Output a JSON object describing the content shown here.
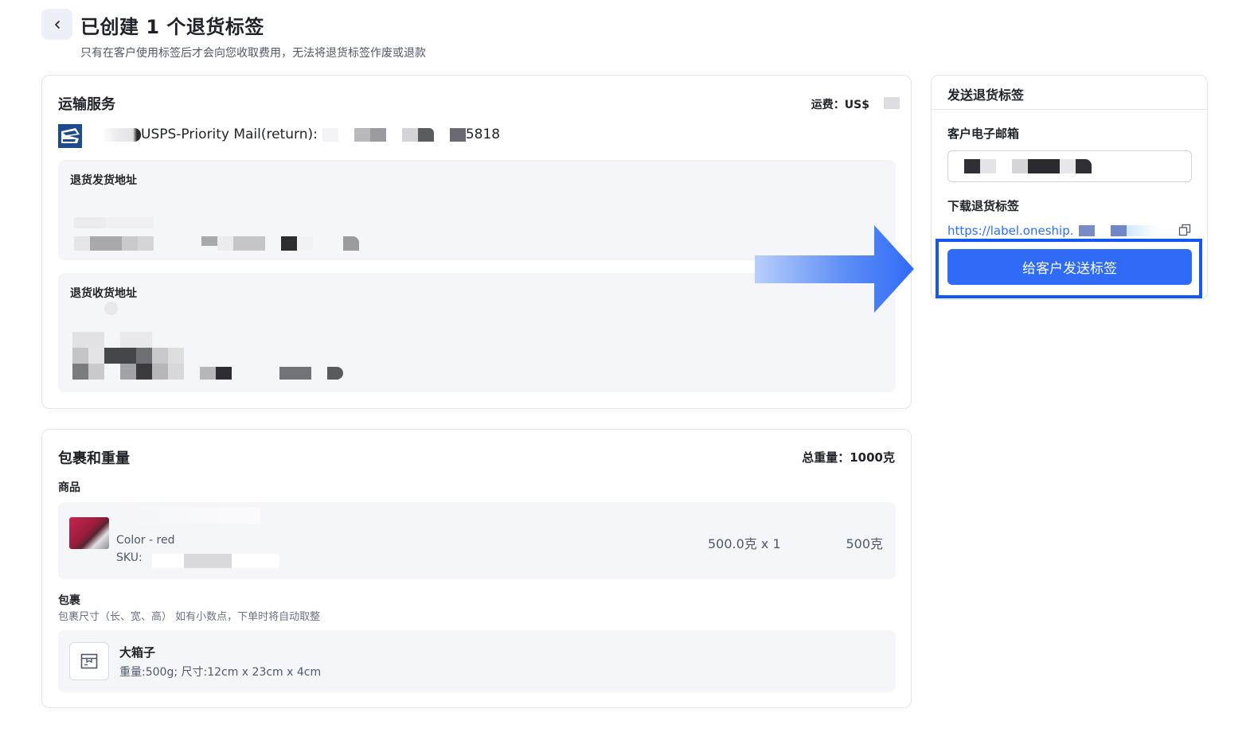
{
  "header": {
    "title": "已创建 1 个退货标签",
    "subtitle": "只有在客户使用标签后才会向您收取费用，无法将退货标签作废或退款",
    "back_icon": "chevron-left-icon"
  },
  "shipping": {
    "title": "运输服务",
    "fee_label": "运费：US$",
    "carrier_icon": "usps-logo-icon",
    "service_name": "USPS-Priority Mail(return):",
    "tracking_suffix": "5818",
    "sender_address_label": "退货发货地址",
    "receiver_address_label": "退货收货地址"
  },
  "package": {
    "title": "包裹和重量",
    "total_weight": "总重量：1000克",
    "products_label": "商品",
    "product": {
      "variant": "Color - red",
      "sku_label": "SKU:",
      "qty": "500.0克 x 1",
      "weight": "500克"
    },
    "parcel_label": "包裹",
    "parcel_hint": "包裹尺寸（长、宽、高） 如有小数点，下单时将自动取整",
    "box_name": "大箱子",
    "box_spec": "重量:500g; 尺寸:12cm x 23cm x 4cm",
    "box_icon": "box-icon"
  },
  "side": {
    "title": "发送退货标签",
    "email_label": "客户电子邮箱",
    "download_label": "下载退货标签",
    "link_text": "https://label.oneship.",
    "copy_icon": "copy-icon",
    "send_button": "给客户发送标签"
  },
  "colors": {
    "primary": "#2f6bf7",
    "link": "#2b6cff",
    "highlight": "#1457f5",
    "panel_bg": "#f5f6fa"
  }
}
